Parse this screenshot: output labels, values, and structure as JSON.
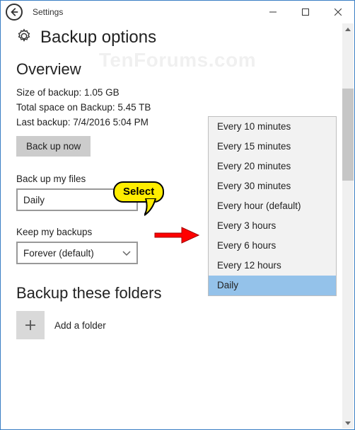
{
  "titlebar": {
    "title": "Settings"
  },
  "header": {
    "title": "Backup options"
  },
  "watermark": "TenForums.com",
  "overview": {
    "heading": "Overview",
    "size_label": "Size of backup: 1.05 GB",
    "space_label": "Total space on Backup: 5.45 TB",
    "last_label": "Last backup: 7/4/2016 5:04 PM",
    "backup_now": "Back up now"
  },
  "backup_files": {
    "label": "Back up my files",
    "value": "Daily"
  },
  "keep_backups": {
    "label": "Keep my backups",
    "value": "Forever (default)"
  },
  "folders": {
    "heading": "Backup these folders",
    "add": "Add a folder"
  },
  "dropdown": {
    "items": [
      "Every 10 minutes",
      "Every 15 minutes",
      "Every 20 minutes",
      "Every 30 minutes",
      "Every hour (default)",
      "Every 3 hours",
      "Every 6 hours",
      "Every 12 hours",
      "Daily"
    ],
    "selected_index": 8
  },
  "annotation": {
    "label": "Select"
  }
}
